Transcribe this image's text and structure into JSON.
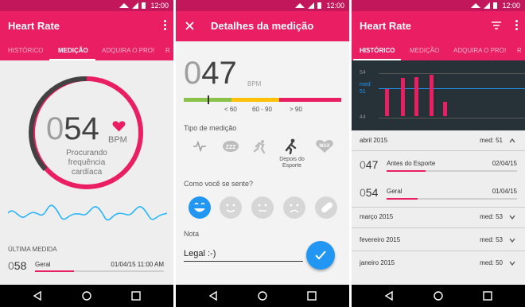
{
  "status": {
    "time": "12:00"
  },
  "screen1": {
    "app_title": "Heart Rate",
    "tabs": [
      "HISTÓRICO",
      "MEDIÇÃO",
      "ADQUIRA O PRO!",
      "R"
    ],
    "bpm_prefix": "0",
    "bpm_value": "54",
    "bpm_unit": "BPM",
    "status_text": "Procurando frequência cardíaca",
    "last_title": "ÚLTIMA MEDIDA",
    "last_prefix": "0",
    "last_value": "58",
    "last_label": "Geral",
    "last_date": "01/04/15 11:00 AM"
  },
  "screen2": {
    "title": "Detalhes da medição",
    "bpm_prefix": "0",
    "bpm_value": "47",
    "bpm_unit": "BPM",
    "scale_labels": [
      "< 60",
      "60 - 90",
      "> 90"
    ],
    "type_title": "Tipo de medição",
    "type_icons": [
      "heartbeat-icon",
      "sleep-icon",
      "running-icon",
      "after-exercise-icon",
      "max-icon"
    ],
    "type_max": "MAX",
    "type_zz": "ZZZ",
    "type_selected_label": "Depois do Esporte",
    "feel_title": "Como você se sente?",
    "moods": [
      "happy",
      "smile",
      "neutral",
      "sad",
      "sick"
    ],
    "note_title": "Nota",
    "note_value": "Legal :-)"
  },
  "screen3": {
    "app_title": "Heart Rate",
    "tabs": [
      "HISTÓRICO",
      "MEDIÇÃO",
      "ADQUIRA O PRO!",
      "R"
    ],
    "chart_labels": {
      "top": "54",
      "med_label": "med",
      "med_value": "51",
      "bottom": "44"
    },
    "months": [
      {
        "name": "abril 2015",
        "med": "med: 51",
        "chevron": "up"
      },
      {
        "name": "março 2015",
        "med": "med: 53",
        "chevron": "down"
      },
      {
        "name": "fevereiro 2015",
        "med": "med: 53",
        "chevron": "down"
      },
      {
        "name": "janeiro 2015",
        "med": "med: 50",
        "chevron": "down"
      }
    ],
    "entries": [
      {
        "prefix": "0",
        "value": "47",
        "label": "Antes do Esporte",
        "date": "02/04/15"
      },
      {
        "prefix": "0",
        "value": "54",
        "label": "Geral",
        "date": "01/04/15"
      }
    ]
  },
  "colors": {
    "accent": "#e91e63",
    "status": "#c2185b",
    "blue": "#2196f3",
    "green": "#8bc34a",
    "yellow": "#ffc107",
    "red": "#e91e63"
  }
}
